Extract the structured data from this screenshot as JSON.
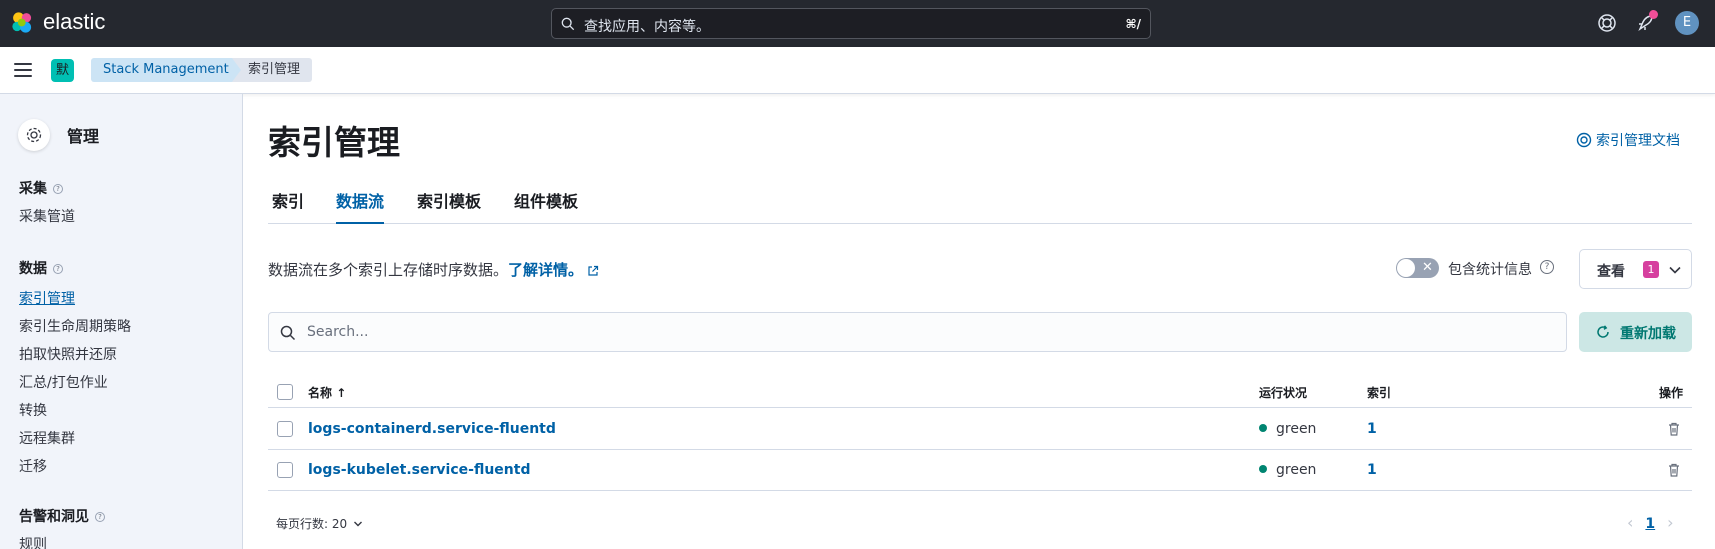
{
  "topbar": {
    "logo_text": "elastic",
    "search_placeholder": "查找应用、内容等。",
    "search_shortcut": "⌘/",
    "avatar_initial": "E"
  },
  "subbar": {
    "space_badge": "默",
    "breadcrumbs": [
      "Stack Management",
      "索引管理"
    ]
  },
  "sidebar": {
    "title": "管理",
    "sections": [
      {
        "heading": "采集",
        "items": [
          "采集管道"
        ]
      },
      {
        "heading": "数据",
        "items": [
          "索引管理",
          "索引生命周期策略",
          "拍取快照并还原",
          "汇总/打包作业",
          "转换",
          "远程集群",
          "迁移"
        ]
      },
      {
        "heading": "告警和洞见",
        "items": [
          "规则"
        ]
      }
    ],
    "active_item": "索引管理"
  },
  "main": {
    "title": "索引管理",
    "doc_link": "索引管理文档",
    "tabs": [
      "索引",
      "数据流",
      "索引模板",
      "组件模板"
    ],
    "active_tab": "数据流",
    "description": "数据流在多个索引上存储时序数据。",
    "learn_more": "了解详情。",
    "toggle_label": "包含统计信息",
    "view_button": "查看",
    "view_badge": "1",
    "search_placeholder": "Search...",
    "reload_button": "重新加载"
  },
  "table": {
    "headers": {
      "name": "名称",
      "health": "运行状况",
      "indices": "索引",
      "actions": "操作"
    },
    "rows": [
      {
        "name": "logs-containerd.service-fluentd",
        "health": "green",
        "indices": "1"
      },
      {
        "name": "logs-kubelet.service-fluentd",
        "health": "green",
        "indices": "1"
      }
    ]
  },
  "footer": {
    "rows_per_page": "每页行数: 20",
    "current_page": "1"
  },
  "colors": {
    "accent": "#0061a6",
    "health_green": "#008571",
    "topbar_bg": "#25282f",
    "reload_bg": "#cce7e5"
  }
}
